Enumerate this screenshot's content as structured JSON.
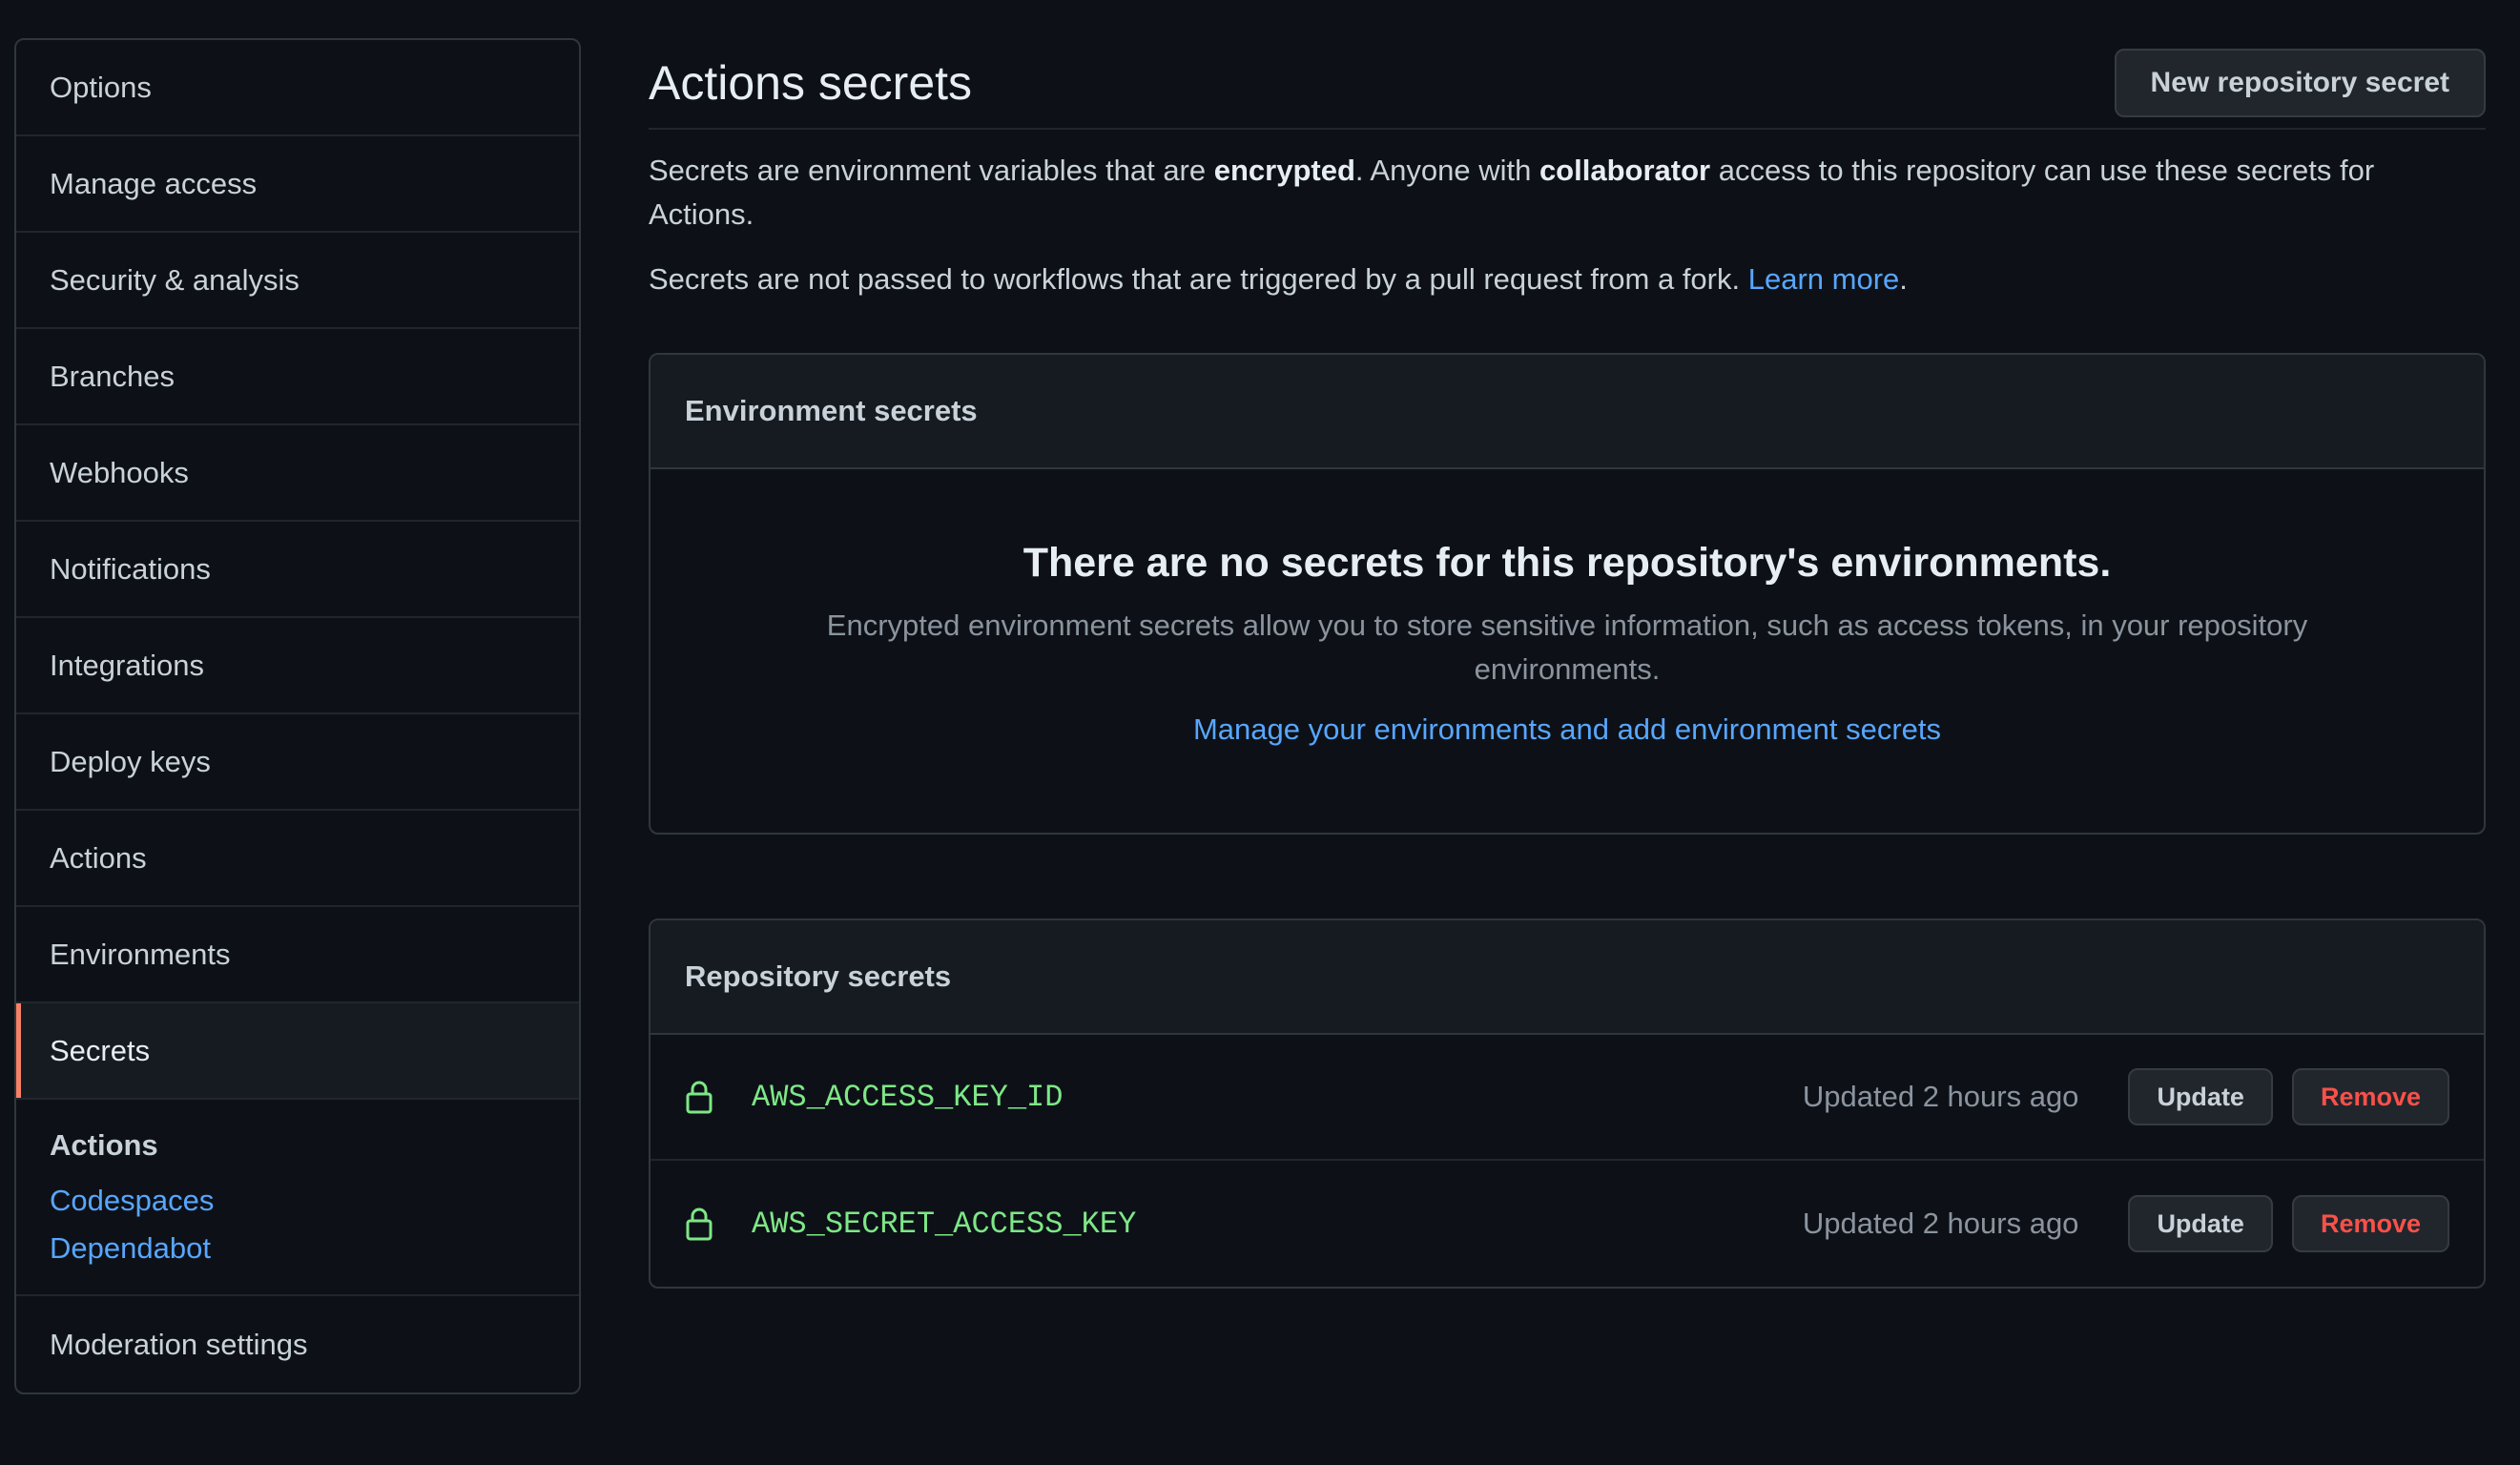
{
  "sidebar": {
    "items": [
      {
        "label": "Options"
      },
      {
        "label": "Manage access"
      },
      {
        "label": "Security & analysis"
      },
      {
        "label": "Branches"
      },
      {
        "label": "Webhooks"
      },
      {
        "label": "Notifications"
      },
      {
        "label": "Integrations"
      },
      {
        "label": "Deploy keys"
      },
      {
        "label": "Actions"
      },
      {
        "label": "Environments"
      },
      {
        "label": "Secrets",
        "active": true
      }
    ],
    "secrets_group": {
      "title": "Actions",
      "links": [
        "Codespaces",
        "Dependabot"
      ]
    },
    "moderation": "Moderation settings"
  },
  "header": {
    "title": "Actions secrets",
    "new_secret_button": "New repository secret"
  },
  "description": {
    "p1_part1": "Secrets are environment variables that are ",
    "p1_bold1": "encrypted",
    "p1_part2": ". Anyone with ",
    "p1_bold2": "collaborator",
    "p1_part3": " access to this repository can use these secrets for Actions.",
    "p2_text": "Secrets are not passed to workflows that are triggered by a pull request from a fork. ",
    "p2_link": "Learn more",
    "p2_end": "."
  },
  "environment_secrets": {
    "title": "Environment secrets",
    "empty_title": "There are no secrets for this repository's environments.",
    "empty_desc": "Encrypted environment secrets allow you to store sensitive information, such as access tokens, in your repository environments.",
    "empty_link": "Manage your environments and add environment secrets"
  },
  "repository_secrets": {
    "title": "Repository secrets",
    "rows": [
      {
        "name": "AWS_ACCESS_KEY_ID",
        "updated": "Updated 2 hours ago",
        "update_label": "Update",
        "remove_label": "Remove"
      },
      {
        "name": "AWS_SECRET_ACCESS_KEY",
        "updated": "Updated 2 hours ago",
        "update_label": "Update",
        "remove_label": "Remove"
      }
    ]
  },
  "icons": {
    "secret_row_icon": "lock-icon"
  },
  "colors": {
    "background": "#0d1117",
    "link": "#58a6ff",
    "secret_name": "#7ee787",
    "remove": "#f85149",
    "active_indicator": "#f78166"
  }
}
